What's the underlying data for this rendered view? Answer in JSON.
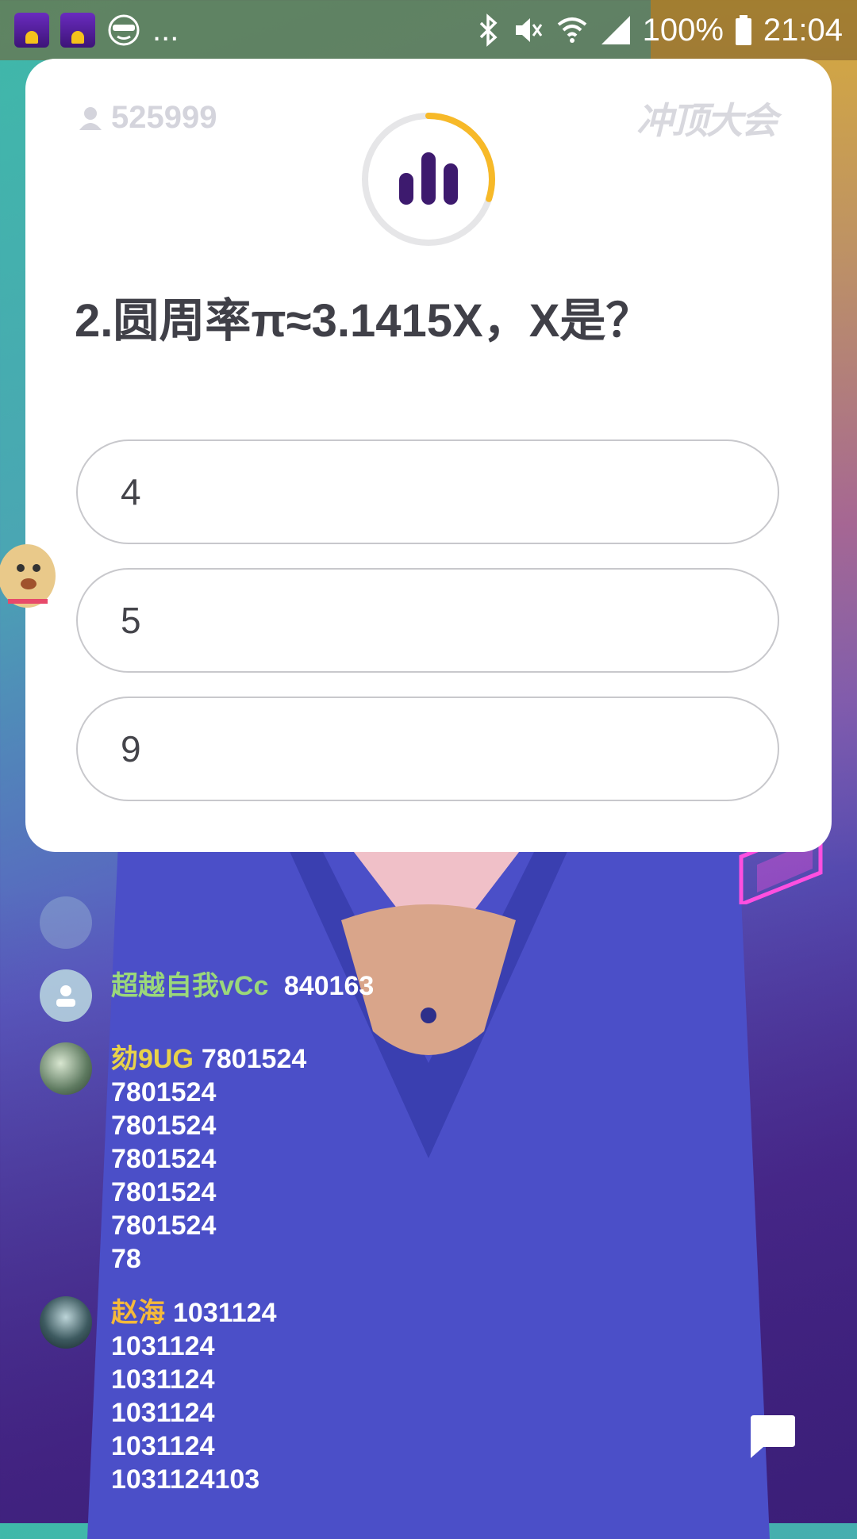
{
  "status_bar": {
    "notification_icons": [
      "app-icon",
      "app-icon",
      "face-icon"
    ],
    "more": "...",
    "battery": "100%",
    "time": "21:04",
    "system_icons": [
      "bluetooth-icon",
      "mute-icon",
      "wifi-icon",
      "signal-icon",
      "battery-icon"
    ]
  },
  "quiz": {
    "viewer_count": "525999",
    "logo": "冲顶大会",
    "timer_progress": 0.3,
    "question": "2.圆周率π≈3.1415X，X是？",
    "options": [
      "4",
      "5",
      "9"
    ]
  },
  "comments": [
    {
      "user": "",
      "text_lines": [
        ""
      ],
      "faded": true
    },
    {
      "user": "超越自我vCc",
      "text_lines": [
        "840163"
      ],
      "user_color": "#9bd87a",
      "faded": false
    },
    {
      "user": "劾9UG",
      "text_lines": [
        "7801524",
        "7801524",
        "7801524",
        "7801524",
        "7801524",
        "7801524",
        "78"
      ],
      "user_color": "#e8d24a"
    },
    {
      "user": "赵海",
      "text_lines": [
        "1031124",
        "1031124",
        "1031124",
        "1031124",
        "1031124",
        "1031124103"
      ],
      "user_color": "#f5b93a"
    }
  ],
  "colors": {
    "accent_timer": "#f7b928",
    "brand_purple": "#3d1a6e"
  }
}
